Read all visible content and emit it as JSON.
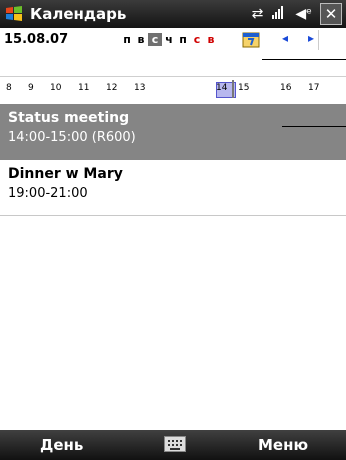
{
  "titlebar": {
    "app_title": "Календарь",
    "start_icon": "windows-flag-icon",
    "close_label": "✕"
  },
  "header": {
    "date": "15.08.07",
    "weekdays": [
      "п",
      "в",
      "с",
      "ч",
      "п",
      "с",
      "в"
    ],
    "selected_weekday_index": 2,
    "hours": [
      "8",
      "9",
      "10",
      "11",
      "12",
      "13",
      "14",
      "15",
      "16",
      "17"
    ]
  },
  "appointments": [
    {
      "title": "Status meeting",
      "time": "14:00-15:00 (R600)"
    },
    {
      "title": "Dinner w Mary",
      "time": "19:00-21:00"
    }
  ],
  "softkeys": {
    "left": "День",
    "right": "Меню"
  },
  "colors": {
    "selection": "#858585",
    "sunday": "#d00000",
    "busy": "#b7b7ee"
  }
}
